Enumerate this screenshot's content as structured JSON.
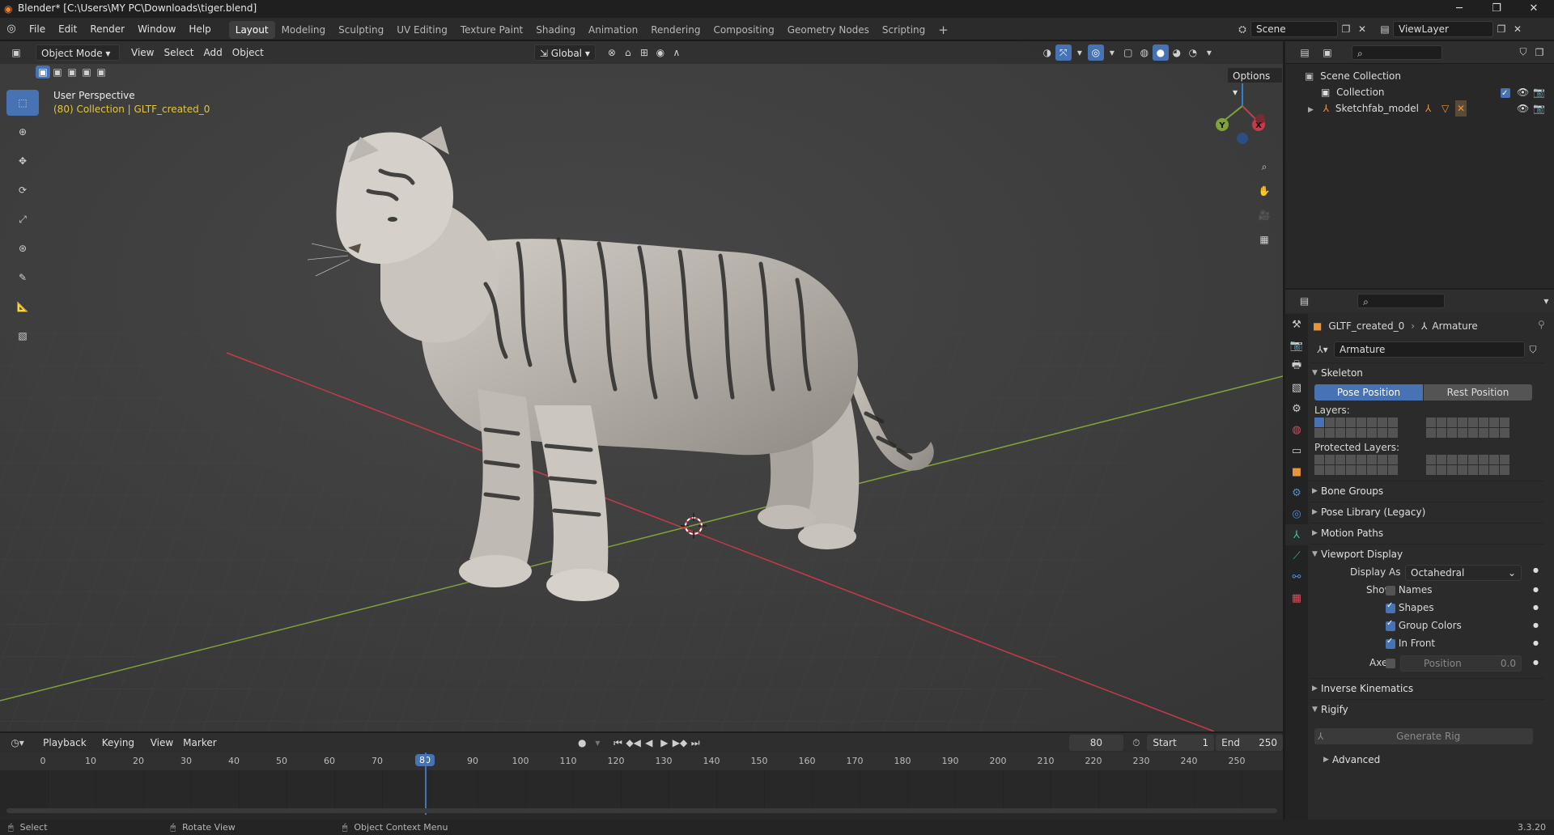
{
  "window": {
    "title": "Blender* [C:\\Users\\MY PC\\Downloads\\tiger.blend]"
  },
  "menu": [
    "File",
    "Edit",
    "Render",
    "Window",
    "Help"
  ],
  "workspaces": [
    "Layout",
    "Modeling",
    "Sculpting",
    "UV Editing",
    "Texture Paint",
    "Shading",
    "Animation",
    "Rendering",
    "Compositing",
    "Geometry Nodes",
    "Scripting"
  ],
  "active_workspace": "Layout",
  "scene": {
    "name": "Scene",
    "view_layer": "ViewLayer"
  },
  "viewport": {
    "mode": "Object Mode",
    "menus": [
      "View",
      "Select",
      "Add",
      "Object"
    ],
    "orientation": "Global",
    "options_label": "Options",
    "perspective_label": "User Perspective",
    "collection_label": "(80) Collection | GLTF_created_0",
    "gizmo_axes": [
      "Z",
      "Y",
      "X"
    ]
  },
  "outliner": {
    "rows": [
      "Scene Collection",
      "Collection",
      "Sketchfab_model"
    ]
  },
  "properties": {
    "breadcrumb_object": "GLTF_created_0",
    "breadcrumb_data": "Armature",
    "data_name": "Armature",
    "skeleton": "Skeleton",
    "pose_position": "Pose Position",
    "rest_position": "Rest Position",
    "layers": "Layers:",
    "protected_layers": "Protected Layers:",
    "bone_groups": "Bone Groups",
    "pose_library": "Pose Library (Legacy)",
    "motion_paths": "Motion Paths",
    "viewport_display": "Viewport Display",
    "display_as_label": "Display As",
    "display_as_value": "Octahedral",
    "show_label": "Show",
    "names": "Names",
    "shapes": "Shapes",
    "group_colors": "Group Colors",
    "in_front": "In Front",
    "axes_label": "Axes",
    "position_label": "Position",
    "position_value": "0.0",
    "inverse_kinematics": "Inverse Kinematics",
    "rigify": "Rigify",
    "generate_rig": "Generate Rig",
    "advanced": "Advanced",
    "checkbox_states": {
      "names": false,
      "shapes": true,
      "group_colors": true,
      "in_front": true,
      "axes": false
    }
  },
  "timeline": {
    "menus": [
      "Playback",
      "Keying",
      "View",
      "Marker"
    ],
    "current_frame": "80",
    "start_label": "Start",
    "start": "1",
    "end_label": "End",
    "end": "250",
    "ticks": [
      "0",
      "10",
      "20",
      "30",
      "40",
      "50",
      "60",
      "70",
      "80",
      "90",
      "100",
      "110",
      "120",
      "130",
      "140",
      "150",
      "160",
      "170",
      "180",
      "190",
      "200",
      "210",
      "220",
      "230",
      "240",
      "250"
    ]
  },
  "statusbar": {
    "select": "Select",
    "rotate": "Rotate View",
    "context": "Object Context Menu",
    "version": "3.3.20"
  },
  "colors": {
    "accent": "#4772b3",
    "viewport_bg": "#3d3d3d",
    "x_axis": "#c43b4a",
    "y_axis": "#7fa33a",
    "z_axis": "#2f7fd6",
    "info_yellow": "#e2c63e"
  }
}
